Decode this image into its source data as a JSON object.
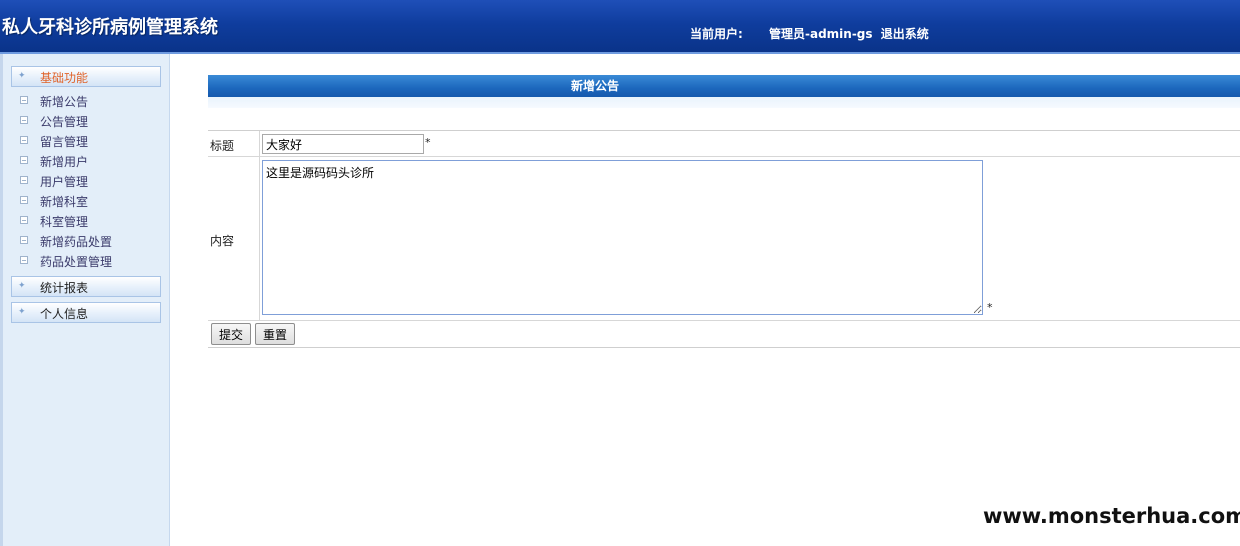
{
  "header": {
    "app_title": "私人牙科诊所病例管理系统",
    "user_label": "当前用户:",
    "user_name": "管理员-admin-gs",
    "logout": "退出系统"
  },
  "sidebar": {
    "groups": [
      {
        "label": "基础功能",
        "active": true
      },
      {
        "label": "统计报表"
      },
      {
        "label": "个人信息"
      }
    ],
    "items": [
      {
        "label": "新增公告"
      },
      {
        "label": "公告管理"
      },
      {
        "label": "留言管理"
      },
      {
        "label": "新增用户"
      },
      {
        "label": "用户管理"
      },
      {
        "label": "新增科室"
      },
      {
        "label": "科室管理"
      },
      {
        "label": "新增药品处置"
      },
      {
        "label": "药品处置管理"
      }
    ]
  },
  "form": {
    "panel_title": "新增公告",
    "title_label": "标题",
    "title_value": "大家好",
    "content_label": "内容",
    "content_value": "这里是源码码头诊所",
    "required_mark": "*",
    "submit_label": "提交",
    "reset_label": "重置"
  },
  "watermark": "www.monsterhua.com",
  "colors": {
    "header_bg": "#0f3d9e",
    "sidebar_bg": "#e3eef9",
    "panel_title_bg": "#1c67bd",
    "active_group_text": "#e0632a"
  }
}
